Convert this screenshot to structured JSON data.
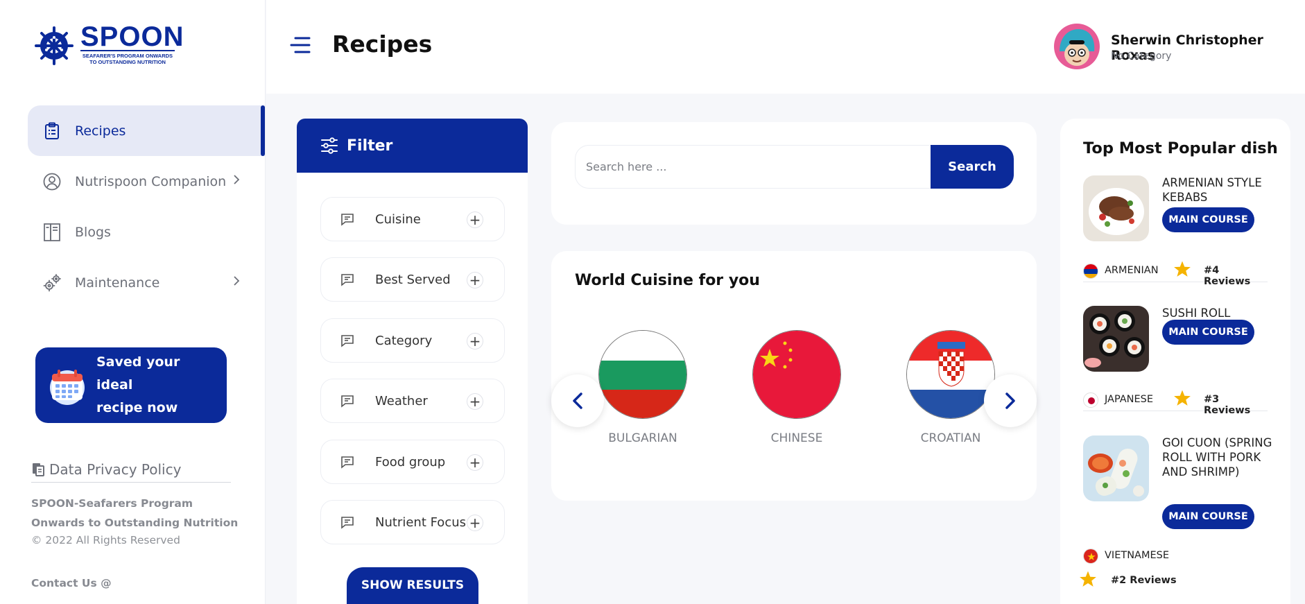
{
  "brand": {
    "name": "SPOON",
    "tagline_line1": "SEAFARER'S PROGRAM ONWARDS",
    "tagline_line2": "TO OUTSTANDING NUTRITION"
  },
  "sidebar": {
    "items": [
      {
        "label": "Recipes",
        "icon": "clipboard-icon",
        "active": true
      },
      {
        "label": "Nutrispoon Companion",
        "icon": "user-circle-icon",
        "has_submenu": true
      },
      {
        "label": "Blogs",
        "icon": "book-icon"
      },
      {
        "label": "Maintenance",
        "icon": "gears-icon",
        "has_submenu": true
      }
    ],
    "promo": {
      "line1": "Saved your ideal",
      "line2": "recipe now",
      "icon": "calendar-icon"
    },
    "privacy_link": "Data Privacy Policy",
    "org_line1": "SPOON-Seafarers Program",
    "org_line2": "Onwards to Outstanding Nutrition",
    "copyright": "© 2022 All Rights Reserved",
    "contact": "Contact Us @"
  },
  "header": {
    "title": "Recipes",
    "user": {
      "name": "Sherwin Christopher Roxas",
      "category": "No Category"
    }
  },
  "filter": {
    "title": "Filter",
    "items": [
      "Cuisine",
      "Best Served",
      "Category",
      "Weather",
      "Food group",
      "Nutrient Focus"
    ],
    "show_results": "SHOW RESULTS"
  },
  "search": {
    "placeholder": "Search here ...",
    "value": "",
    "button": "Search"
  },
  "world_cuisine": {
    "title": "World Cuisine for you",
    "cuisines": [
      "BULGARIAN",
      "CHINESE",
      "CROATIAN"
    ]
  },
  "popular": {
    "title": "Top Most Popular dish",
    "dishes": [
      {
        "name": "ARMENIAN STYLE KEBABS",
        "course": "MAIN COURSE",
        "country": "ARMENIAN",
        "reviews": "#4 Reviews"
      },
      {
        "name": "SUSHI ROLL",
        "course": "MAIN COURSE",
        "country": "JAPANESE",
        "reviews": "#3 Reviews"
      },
      {
        "name": "GOI CUON (SPRING ROLL WITH PORK AND SHRIMP)",
        "course": "MAIN COURSE",
        "country": "VIETNAMESE",
        "reviews": "#2 Reviews"
      }
    ]
  },
  "colors": {
    "primary": "#0b2a9a",
    "active_bg": "#e6e9f6",
    "star": "#f5b301"
  }
}
